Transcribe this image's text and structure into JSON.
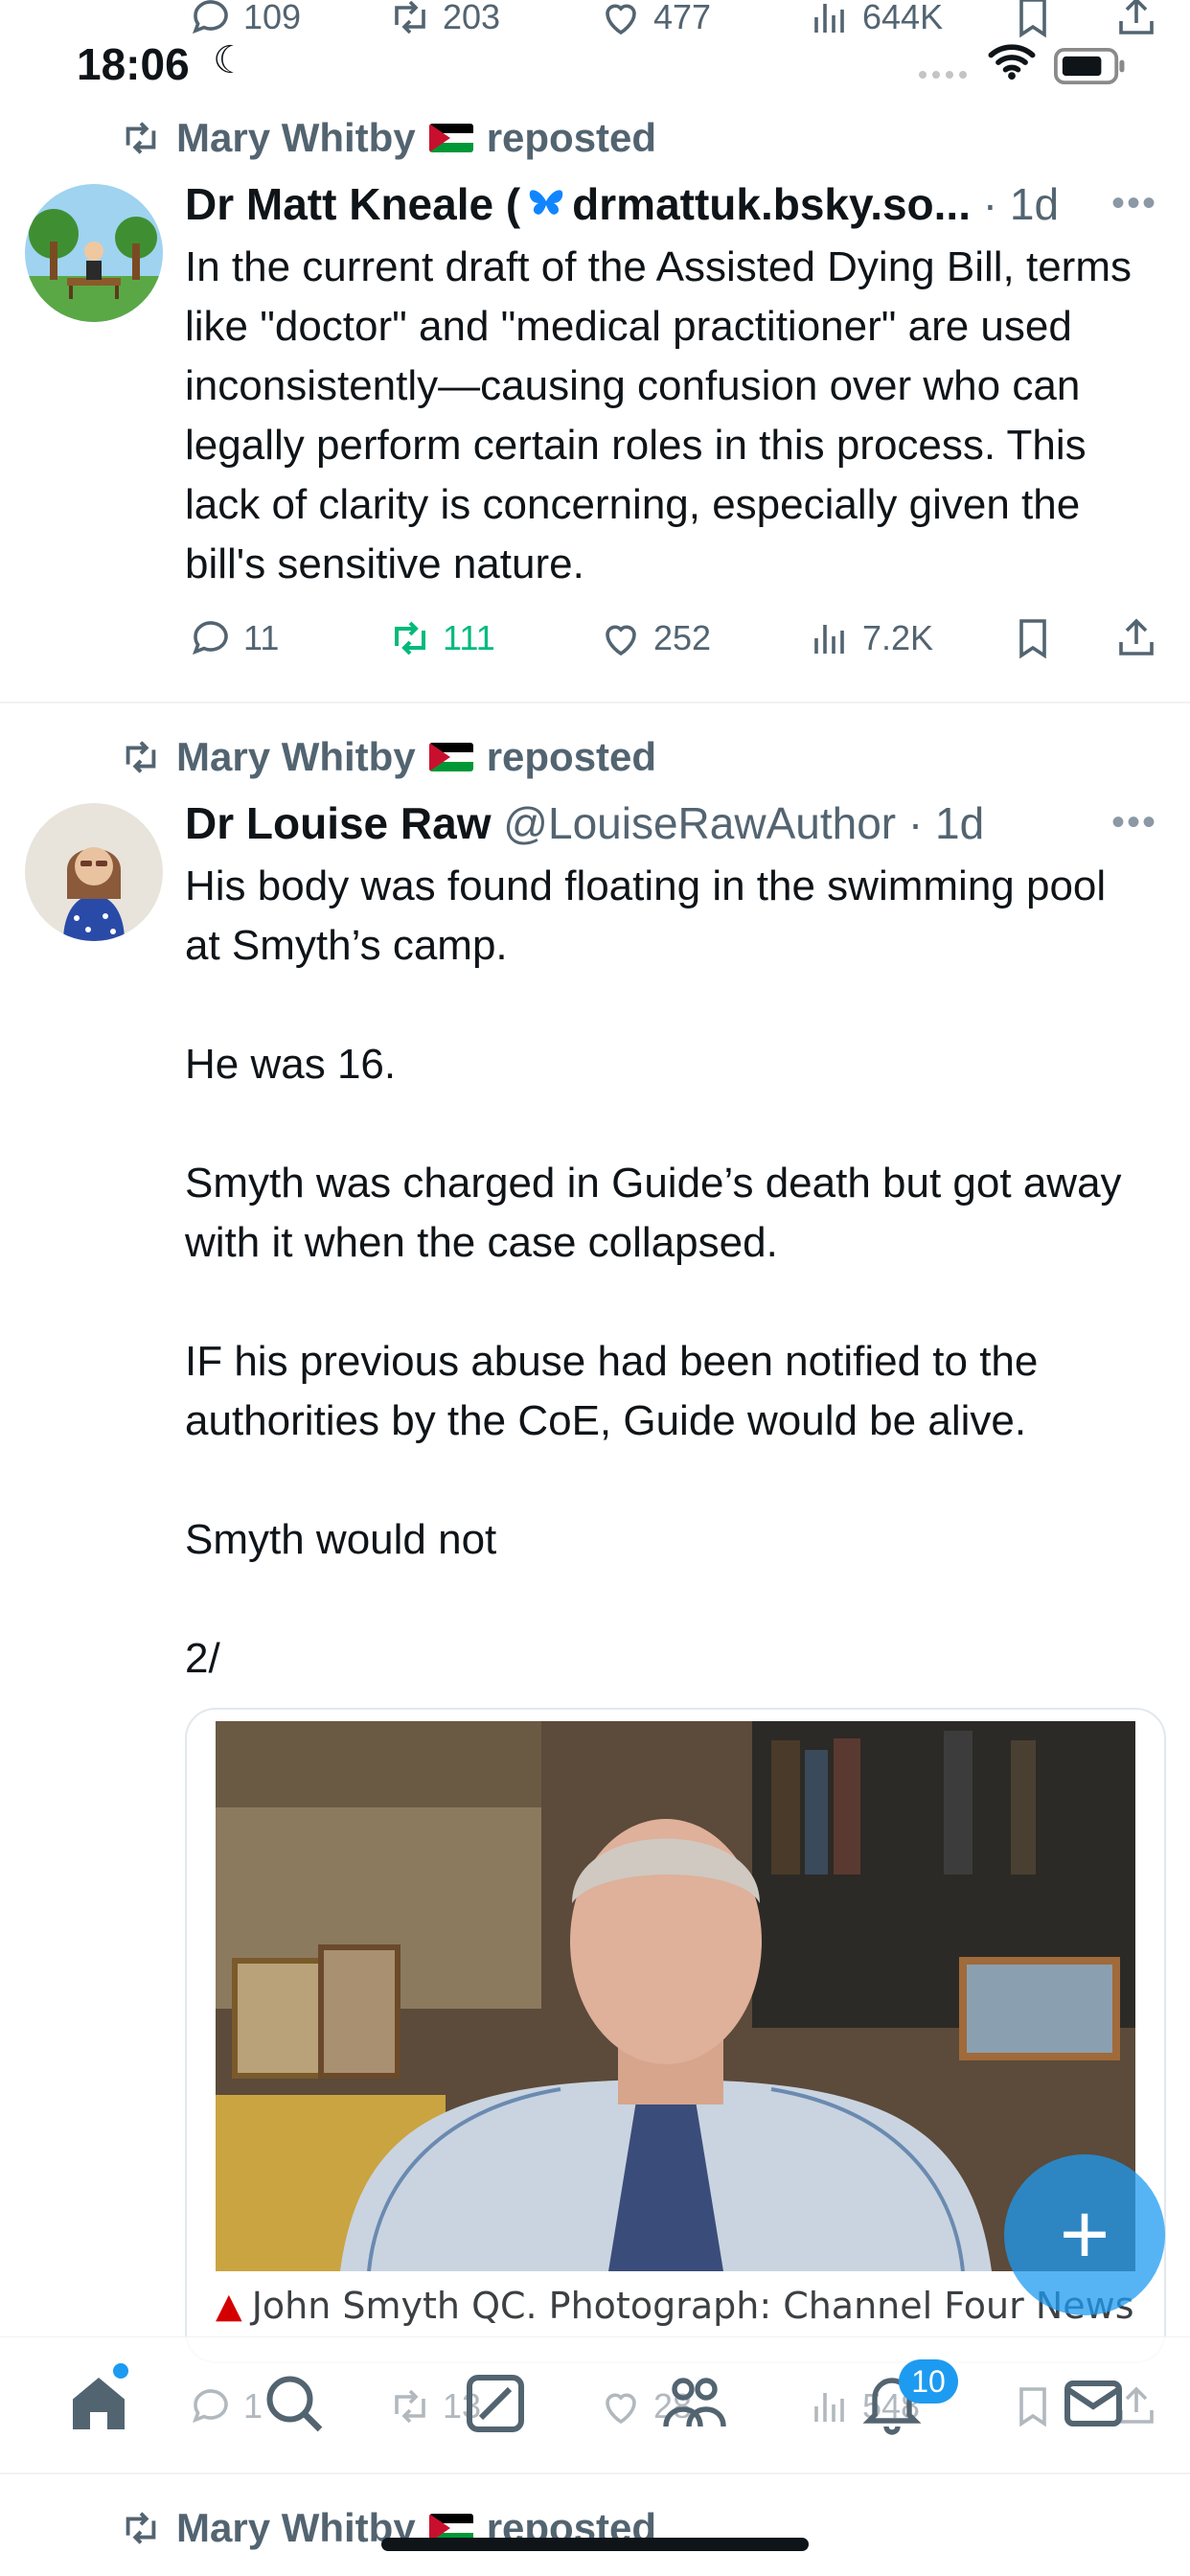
{
  "status_bar": {
    "time": "18:06"
  },
  "prev_tweet_actions": {
    "replies": "109",
    "reposts": "203",
    "likes": "477",
    "views": "644K"
  },
  "tweets": [
    {
      "repost_by": "Mary Whitby",
      "reposted_label": "reposted",
      "author": "Dr Matt Kneale (",
      "author_suffix": "drmattuk.bsky.so...",
      "time": "1d",
      "text": "In the current draft of the Assisted Dying Bill, terms like \"doctor\" and \"medical practitioner\" are used inconsistently—causing confusion over who can legally perform certain roles in this process. This lack of clarity is concerning, especially given the bill's sensitive nature.",
      "replies": "11",
      "reposts": "111",
      "likes": "252",
      "views": "7.2K"
    },
    {
      "repost_by": "Mary Whitby",
      "reposted_label": "reposted",
      "author": "Dr Louise Raw",
      "handle": "@LouiseRawAuthor",
      "time": "1d",
      "text": "His body was found floating in the swimming pool at Smyth’s camp.\n\nHe was 16.\n\nSmyth was charged in Guide’s death but got away with it when the case collapsed.\n\nIF his previous abuse had been notified to the authorities by the CoE, Guide would be alive.\n\nSmyth would not\n\n2/",
      "media_caption": "John Smyth QC. Photograph: Channel Four News",
      "partial_actions": {
        "replies": "1",
        "reposts": "13",
        "likes": "28",
        "views": "548"
      }
    }
  ],
  "next_repost": {
    "repost_by": "Mary Whitby",
    "reposted_label": "reposted"
  },
  "fab": {
    "label": "+"
  },
  "bottom_nav": {
    "notifications_badge": "10"
  },
  "colors": {
    "accent": "#1d9bf0",
    "repost_green": "#00ba7c",
    "muted": "#536471"
  }
}
